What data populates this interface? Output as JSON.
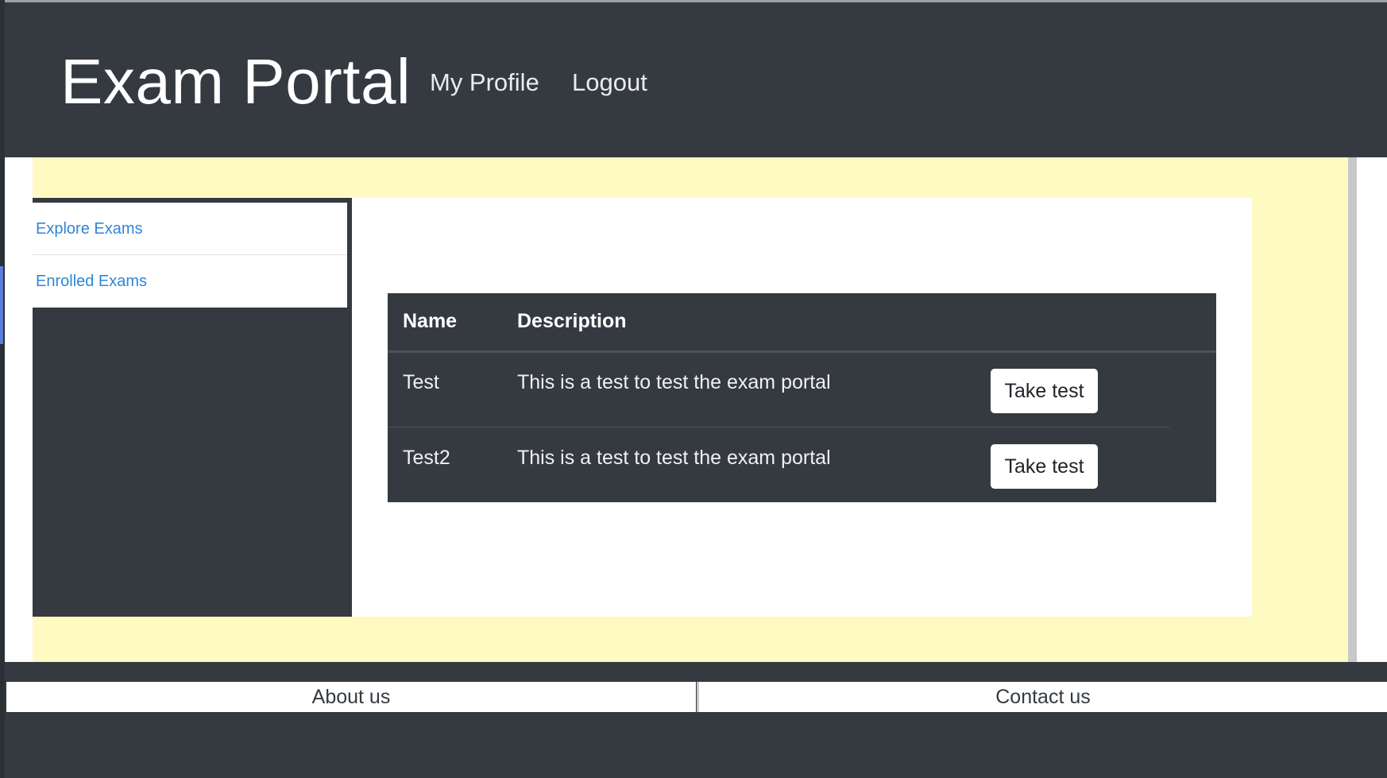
{
  "header": {
    "brand": "Exam Portal",
    "nav": {
      "profile": "My Profile",
      "logout": "Logout"
    }
  },
  "sidebar": {
    "items": [
      {
        "label": "Explore Exams"
      },
      {
        "label": "Enrolled Exams"
      }
    ]
  },
  "table": {
    "headers": {
      "name": "Name",
      "description": "Description"
    },
    "rows": [
      {
        "name": "Test",
        "description": "This is a test to test the exam portal",
        "action": "Take test"
      },
      {
        "name": "Test2",
        "description": "This is a test to test the exam portal",
        "action": "Take test"
      }
    ]
  },
  "footer": {
    "about": "About us",
    "contact": "Contact us"
  },
  "colors": {
    "dark": "#343a40",
    "highlight": "#fff9c2",
    "link": "#2f86d9",
    "white": "#ffffff"
  }
}
